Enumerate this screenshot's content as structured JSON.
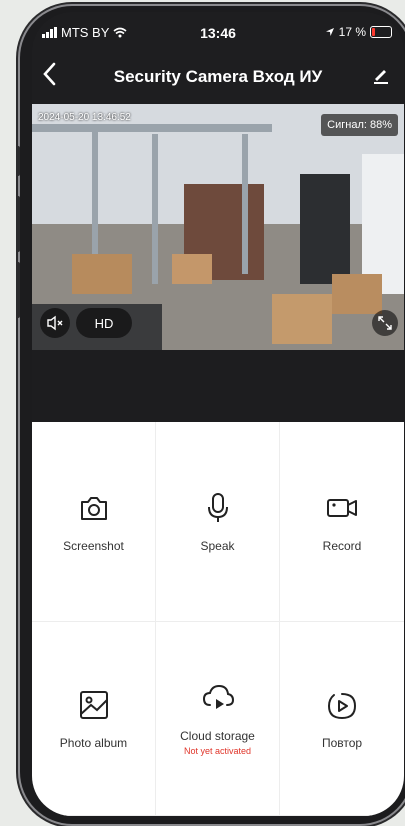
{
  "status_bar": {
    "carrier": "MTS BY",
    "time": "13:46",
    "battery": "17 %"
  },
  "header": {
    "title": "Security Camera Вход ИУ"
  },
  "video": {
    "timestamp": "2024-05-20 13:46:52",
    "signal": "Сигнал: 88%",
    "quality": "HD"
  },
  "actions": {
    "screenshot": "Screenshot",
    "speak": "Speak",
    "record": "Record",
    "photo_album": "Photo album",
    "cloud_storage": "Cloud storage",
    "cloud_status": "Not yet activated",
    "replay": "Повтор"
  },
  "colors": {
    "accent_status": "#e0352a",
    "background": "#1e1e20"
  }
}
